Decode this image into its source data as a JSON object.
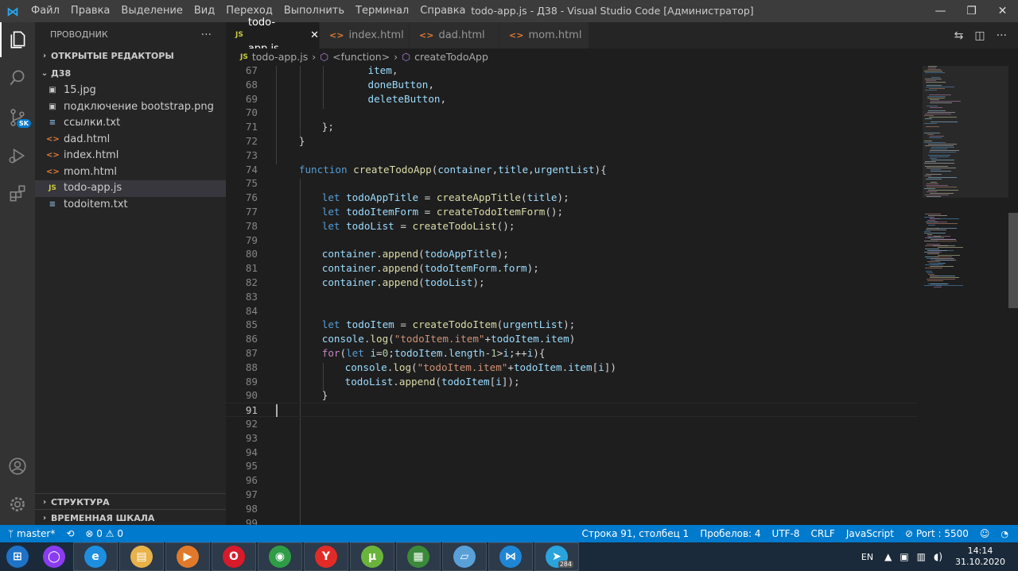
{
  "window": {
    "title": "todo-app.js - Д38 - Visual Studio Code [Администратор]",
    "menu": [
      "Файл",
      "Правка",
      "Выделение",
      "Вид",
      "Переход",
      "Выполнить",
      "Терминал",
      "Справка"
    ],
    "controls": [
      "—",
      "❐",
      "✕"
    ]
  },
  "activity_bar": {
    "items": [
      "files-icon",
      "search-icon",
      "source-control-icon",
      "run-debug-icon",
      "extensions-icon"
    ],
    "scm_badge": "SK",
    "bottom": [
      "account-icon",
      "manage-gear-icon"
    ]
  },
  "sidebar": {
    "title": "ПРОВОДНИК",
    "more": "···",
    "open_editors": "ОТКРЫТЫЕ РЕДАКТОРЫ",
    "folder": "Д38",
    "files": [
      {
        "name": "15.jpg",
        "icon": "image",
        "glyph": "▣"
      },
      {
        "name": "подключение bootstrap.png",
        "icon": "image",
        "glyph": "▣"
      },
      {
        "name": "ссылки.txt",
        "icon": "txt",
        "glyph": "≡"
      },
      {
        "name": "dad.html",
        "icon": "html",
        "glyph": "<>"
      },
      {
        "name": "index.html",
        "icon": "html",
        "glyph": "<>"
      },
      {
        "name": "mom.html",
        "icon": "html",
        "glyph": "<>"
      },
      {
        "name": "todo-app.js",
        "icon": "js",
        "glyph": "JS"
      },
      {
        "name": "todoitem.txt",
        "icon": "txt",
        "glyph": "≡"
      }
    ],
    "selected_index": 6,
    "outline": "СТРУКТУРА",
    "timeline": "ВРЕМЕННАЯ ШКАЛА"
  },
  "tabs": [
    {
      "label": "todo-app.js",
      "icon": "JS",
      "active": true
    },
    {
      "label": "index.html",
      "icon": "<>",
      "active": false
    },
    {
      "label": "dad.html",
      "icon": "<>",
      "active": false
    },
    {
      "label": "mom.html",
      "icon": "<>",
      "active": false
    }
  ],
  "breadcrumb": {
    "file": "todo-app.js",
    "file_icon": "JS",
    "items": [
      "<function>",
      "createTodoApp"
    ],
    "sep": "›"
  },
  "editor": {
    "current_line": 91,
    "lines": [
      {
        "n": "67",
        "t": [
          [
            "v",
            "item"
          ],
          [
            "p",
            ","
          ]
        ],
        "indent": 16
      },
      {
        "n": "68",
        "t": [
          [
            "v",
            "doneButton"
          ],
          [
            "p",
            ","
          ]
        ],
        "indent": 16
      },
      {
        "n": "69",
        "t": [
          [
            "v",
            "deleteButton"
          ],
          [
            "p",
            ","
          ]
        ],
        "indent": 16
      },
      {
        "n": "70",
        "t": [],
        "indent": 0
      },
      {
        "n": "71",
        "t": [
          [
            "p",
            "};"
          ]
        ],
        "indent": 8
      },
      {
        "n": "72",
        "t": [
          [
            "p",
            "}"
          ]
        ],
        "indent": 4
      },
      {
        "n": "73",
        "t": [],
        "indent": 0
      },
      {
        "n": "74",
        "t": [
          [
            "k",
            "function"
          ],
          [
            "p",
            " "
          ],
          [
            "f",
            "createTodoApp"
          ],
          [
            "p",
            "("
          ],
          [
            "v",
            "container"
          ],
          [
            "p",
            ","
          ],
          [
            "v",
            "title"
          ],
          [
            "p",
            ","
          ],
          [
            "v",
            "urgentList"
          ],
          [
            "p",
            "){"
          ]
        ],
        "indent": 4
      },
      {
        "n": "75",
        "t": [],
        "indent": 0
      },
      {
        "n": "76",
        "t": [
          [
            "k",
            "let"
          ],
          [
            "p",
            " "
          ],
          [
            "v",
            "todoAppTitle"
          ],
          [
            "p",
            " = "
          ],
          [
            "f",
            "createAppTitle"
          ],
          [
            "p",
            "("
          ],
          [
            "v",
            "title"
          ],
          [
            "p",
            ");"
          ]
        ],
        "indent": 8
      },
      {
        "n": "77",
        "t": [
          [
            "k",
            "let"
          ],
          [
            "p",
            " "
          ],
          [
            "v",
            "todoItemForm"
          ],
          [
            "p",
            " = "
          ],
          [
            "f",
            "createTodoItemForm"
          ],
          [
            "p",
            "();"
          ]
        ],
        "indent": 8
      },
      {
        "n": "78",
        "t": [
          [
            "k",
            "let"
          ],
          [
            "p",
            " "
          ],
          [
            "v",
            "todoList"
          ],
          [
            "p",
            " = "
          ],
          [
            "f",
            "createTodoList"
          ],
          [
            "p",
            "();"
          ]
        ],
        "indent": 8
      },
      {
        "n": "79",
        "t": [],
        "indent": 0
      },
      {
        "n": "80",
        "t": [
          [
            "v",
            "container"
          ],
          [
            "p",
            "."
          ],
          [
            "f",
            "append"
          ],
          [
            "p",
            "("
          ],
          [
            "v",
            "todoAppTitle"
          ],
          [
            "p",
            ");"
          ]
        ],
        "indent": 8
      },
      {
        "n": "81",
        "t": [
          [
            "v",
            "container"
          ],
          [
            "p",
            "."
          ],
          [
            "f",
            "append"
          ],
          [
            "p",
            "("
          ],
          [
            "v",
            "todoItemForm"
          ],
          [
            "p",
            "."
          ],
          [
            "v",
            "form"
          ],
          [
            "p",
            ");"
          ]
        ],
        "indent": 8
      },
      {
        "n": "82",
        "t": [
          [
            "v",
            "container"
          ],
          [
            "p",
            "."
          ],
          [
            "f",
            "append"
          ],
          [
            "p",
            "("
          ],
          [
            "v",
            "todoList"
          ],
          [
            "p",
            ");"
          ]
        ],
        "indent": 8
      },
      {
        "n": "83",
        "t": [],
        "indent": 0
      },
      {
        "n": "84",
        "t": [],
        "indent": 0
      },
      {
        "n": "85",
        "t": [
          [
            "k",
            "let"
          ],
          [
            "p",
            " "
          ],
          [
            "v",
            "todoItem"
          ],
          [
            "p",
            " = "
          ],
          [
            "f",
            "createTodoItem"
          ],
          [
            "p",
            "("
          ],
          [
            "v",
            "urgentList"
          ],
          [
            "p",
            ");"
          ]
        ],
        "indent": 8
      },
      {
        "n": "86",
        "t": [
          [
            "v",
            "console"
          ],
          [
            "p",
            "."
          ],
          [
            "f",
            "log"
          ],
          [
            "p",
            "("
          ],
          [
            "s",
            "\"todoItem.item\""
          ],
          [
            "p",
            "+"
          ],
          [
            "v",
            "todoItem"
          ],
          [
            "p",
            "."
          ],
          [
            "v",
            "item"
          ],
          [
            "p",
            ")"
          ]
        ],
        "indent": 8
      },
      {
        "n": "87",
        "t": [
          [
            "c",
            "for"
          ],
          [
            "p",
            "("
          ],
          [
            "k",
            "let"
          ],
          [
            "p",
            " "
          ],
          [
            "v",
            "i"
          ],
          [
            "p",
            "="
          ],
          [
            "n",
            "0"
          ],
          [
            "p",
            ";"
          ],
          [
            "v",
            "todoItem"
          ],
          [
            "p",
            "."
          ],
          [
            "v",
            "length"
          ],
          [
            "p",
            "-"
          ],
          [
            "n",
            "1"
          ],
          [
            "p",
            ">"
          ],
          [
            "v",
            "i"
          ],
          [
            "p",
            ";++"
          ],
          [
            "v",
            "i"
          ],
          [
            "p",
            "){"
          ]
        ],
        "indent": 8
      },
      {
        "n": "88",
        "t": [
          [
            "v",
            "console"
          ],
          [
            "p",
            "."
          ],
          [
            "f",
            "log"
          ],
          [
            "p",
            "("
          ],
          [
            "s",
            "\"todoItem.item\""
          ],
          [
            "p",
            "+"
          ],
          [
            "v",
            "todoItem"
          ],
          [
            "p",
            "."
          ],
          [
            "v",
            "item"
          ],
          [
            "p",
            "["
          ],
          [
            "v",
            "i"
          ],
          [
            "p",
            "])"
          ]
        ],
        "indent": 12
      },
      {
        "n": "89",
        "t": [
          [
            "v",
            "todoList"
          ],
          [
            "p",
            "."
          ],
          [
            "f",
            "append"
          ],
          [
            "p",
            "("
          ],
          [
            "v",
            "todoItem"
          ],
          [
            "p",
            "["
          ],
          [
            "v",
            "i"
          ],
          [
            "p",
            "]);"
          ]
        ],
        "indent": 12
      },
      {
        "n": "90",
        "t": [
          [
            "p",
            "}"
          ]
        ],
        "indent": 8
      },
      {
        "n": "91",
        "t": [],
        "indent": 0
      },
      {
        "n": "92",
        "t": [],
        "indent": 0
      },
      {
        "n": "93",
        "t": [],
        "indent": 0
      },
      {
        "n": "94",
        "t": [],
        "indent": 0
      },
      {
        "n": "95",
        "t": [],
        "indent": 0
      },
      {
        "n": "96",
        "t": [],
        "indent": 0
      },
      {
        "n": "97",
        "t": [],
        "indent": 0
      },
      {
        "n": "98",
        "t": [],
        "indent": 0
      },
      {
        "n": "99",
        "t": [],
        "indent": 0
      }
    ]
  },
  "statusbar": {
    "branch": "master*",
    "sync": "⟲",
    "errors": "⊗ 0",
    "warnings": "⚠ 0",
    "position": "Строка 91, столбец 1",
    "spaces": "Пробелов: 4",
    "encoding": "UTF-8",
    "eol": "CRLF",
    "language": "JavaScript",
    "port": "⊘ Port : 5500",
    "feedback": "☺",
    "bell": "🔔"
  },
  "taskbar": {
    "apps": [
      {
        "name": "start",
        "glyph": "⊞",
        "color": "#1e73c8"
      },
      {
        "name": "alice",
        "glyph": "◯",
        "color": "#8a3cf0"
      },
      {
        "name": "internet-explorer",
        "glyph": "e",
        "color": "#1e8fe0"
      },
      {
        "name": "file-explorer",
        "glyph": "▤",
        "color": "#e8b24a"
      },
      {
        "name": "media-player",
        "glyph": "▶",
        "color": "#e07a2a"
      },
      {
        "name": "opera",
        "glyph": "O",
        "color": "#d81a2a"
      },
      {
        "name": "chrome",
        "glyph": "◉",
        "color": "#2f9d46"
      },
      {
        "name": "yandex",
        "glyph": "Y",
        "color": "#e22b26"
      },
      {
        "name": "utorrent",
        "glyph": "µ",
        "color": "#6bb43c"
      },
      {
        "name": "task-manager",
        "glyph": "▦",
        "color": "#3a8a3a"
      },
      {
        "name": "notepad",
        "glyph": "▱",
        "color": "#5aa0d8"
      },
      {
        "name": "vscode",
        "glyph": "⋈",
        "color": "#1f86d6"
      },
      {
        "name": "telegram",
        "glyph": "➤",
        "color": "#2aa3dc"
      }
    ],
    "telegram_badge": "284",
    "lang": "EN",
    "time": "14:14",
    "date": "31.10.2020"
  }
}
